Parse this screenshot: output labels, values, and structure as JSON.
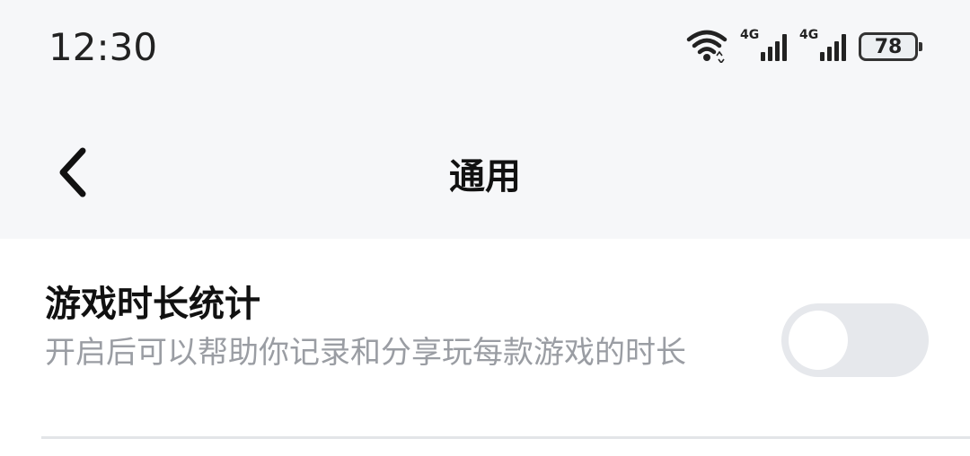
{
  "status_bar": {
    "time": "12:30",
    "signal_1_label": "4G",
    "signal_2_label": "4G",
    "battery_level": "78",
    "icons": [
      "wifi-icon",
      "cellular-signal-icon",
      "cellular-signal-icon",
      "battery-icon"
    ]
  },
  "nav": {
    "back_icon": "chevron-left-icon",
    "title": "通用"
  },
  "settings": {
    "game_time_stats": {
      "title": "游戏时长统计",
      "description": "开启后可以帮助你记录和分享玩每款游戏的时长",
      "enabled": false
    }
  },
  "colors": {
    "background": "#f6f7f9",
    "card": "#ffffff",
    "toggle_off": "#e6e8ec",
    "description_text": "#9a9da3"
  }
}
